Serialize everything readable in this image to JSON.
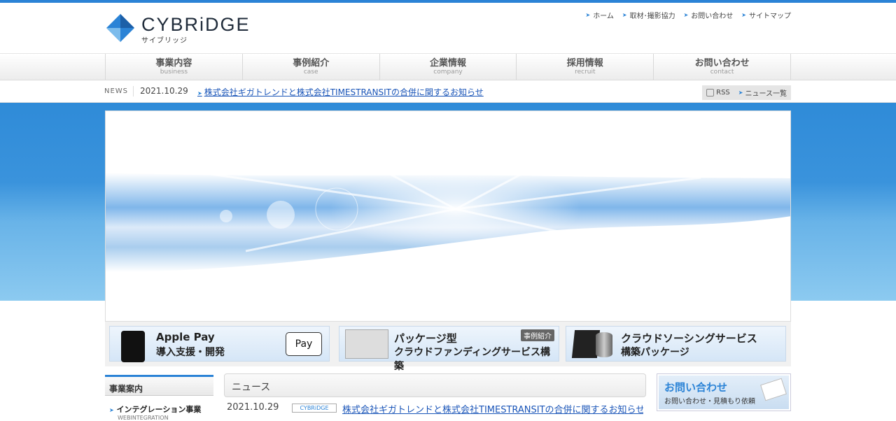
{
  "header": {
    "logo_text": "CYBRiDGE",
    "logo_sub": "サイブリッジ",
    "util_links": [
      "ホーム",
      "取材･撮影協力",
      "お問い合わせ",
      "サイトマップ"
    ]
  },
  "gnav": [
    {
      "ja": "事業内容",
      "en": "business"
    },
    {
      "ja": "事例紹介",
      "en": "case"
    },
    {
      "ja": "企業情報",
      "en": "company"
    },
    {
      "ja": "採用情報",
      "en": "recruit"
    },
    {
      "ja": "お問い合わせ",
      "en": "contact"
    }
  ],
  "newsbar": {
    "label": "NEWS",
    "date": "2021.10.29",
    "link": "株式会社ギガトレンドと株式会社TIMESTRANSITの合併に関するお知らせ",
    "rss": "RSS",
    "list": "ニュース一覧"
  },
  "banners": [
    {
      "line1": "Apple Pay",
      "line2": "導入支援・開発",
      "badge": " Pay"
    },
    {
      "line1": "パッケージ型",
      "line2": "クラウドファンディングサービス構築",
      "tag": "事例紹介"
    },
    {
      "line1": "クラウドソーシングサービス",
      "line2": "構築パッケージ"
    }
  ],
  "side": {
    "heading": "事業案内",
    "item": "インテグレーション事業",
    "item_en": "WEBINTEGRATION"
  },
  "main": {
    "heading": "ニュース",
    "news_date": "2021.10.29",
    "news_tag": "CYBRiDGE",
    "news_link": "株式会社ギガトレンドと株式会社TIMESTRANSITの合併に関するお知らせ"
  },
  "contact": {
    "title": "お問い合わせ",
    "sub": "お問い合わせ・見積もり依頼"
  },
  "colors": {
    "accent": "#2b83d6",
    "link": "#1a55b8"
  }
}
